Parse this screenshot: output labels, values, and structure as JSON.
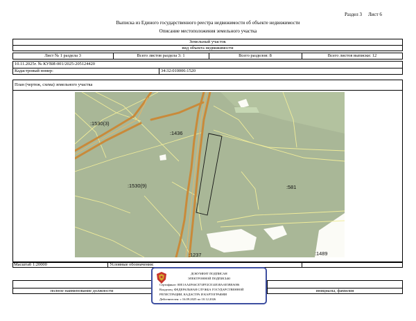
{
  "header": {
    "section_label": "Раздел 3",
    "sheet_label": "Лист 6",
    "title": "Выписка из Единого государственного реестра недвижимости об объекте недвижимости",
    "subtitle": "Описание местоположения земельного участка"
  },
  "object": {
    "type": "Земельный участок",
    "type_caption": "вид объекта недвижимости"
  },
  "sheet_info": {
    "sheet_no": "Лист № 1 раздела 3",
    "section_sheets": "Всего листов раздела 3: 1",
    "sections_total": "Всего разделов: 8",
    "extract_sheets": "Всего листов выписки: 12"
  },
  "doc_number": "10.11.2025г. № КУВИ-001/2025-205124420",
  "cadastral": {
    "label": "Кадастровый номер:",
    "value": "34:32:010006:1520"
  },
  "plan_title": "План (чертеж, схема) земельного участка",
  "map": {
    "parcels": [
      ":1530(3)",
      ":1436",
      ":1530(9)",
      ":581",
      ":1237",
      ":1489"
    ],
    "background_color": "#a9b797",
    "road_color": "#c98a3a",
    "boundary_color": "#f1ed9a"
  },
  "scale": {
    "label": "Масштаб 1:20000",
    "legend_label": "Условные обозначения:"
  },
  "signature": {
    "position_caption": "полное наименование должности",
    "name_caption": "инициалы, фамилия"
  },
  "stamp": {
    "line1": "ДОКУМЕНТ ПОДПИСАН",
    "line2": "ЭЛЕКТРОННОЙ ПОДПИСЬЮ",
    "cert": "Сертификат: 00E1AA4FA6CE74FF2CE14E38AAE5B8A006",
    "owner1": "Владелец: ФЕДЕРАЛЬНАЯ СЛУЖБА ГОСУДАРСТВЕННОЙ",
    "owner2": "РЕГИСТРАЦИИ, КАДАСТРА И КАРТОГРАФИИ",
    "validity": "Действителен: с 16.09.2025 по 10.12.2026",
    "border_color": "#3d4ea0"
  }
}
